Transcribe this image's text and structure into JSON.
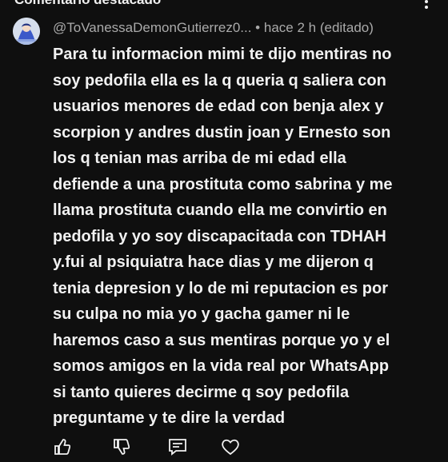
{
  "section": {
    "title": "Comentario destacado"
  },
  "comment": {
    "author": "@ToVanessaDemonGutierrez0...",
    "separator": " • ",
    "time": "hace 2 h",
    "edited": "(editado)",
    "lines": [
      "Para tu informacion mimi te dijo mentiras no",
      "soy pedofila ella es la q queria q saliera con",
      "usuarios menores de edad  con benja alex y",
      "scorpion  y andres  dustin  joan y Ernesto  son",
      "los q tenian mas arriba de mi edad ella",
      "defiende a  una prostituta como sabrina y me",
      "llama prostituta cuando ella me convirtio en",
      "pedofila   y yo soy discapacitada  con TDHAH",
      "y.fui al psiquiatra   hace dias  y me dijeron q",
      "tenia depresion y lo de mi reputacion es por",
      "su culpa no mia yo y gacha gamer ni le",
      "haremos caso a sus mentiras porque yo y el",
      "somos amigos en la vida real por WhatsApp",
      "si tanto quieres decirme q soy pedofila",
      "preguntame y te dire la verdad"
    ]
  },
  "icons": {
    "avatar": "avatar-image",
    "more": "more-vert-icon",
    "like": "thumb-up-icon",
    "dislike": "thumb-down-icon",
    "reply": "reply-icon",
    "heart": "heart-icon"
  },
  "colors": {
    "background": "#0f0f0f",
    "text": "#f1f1f1",
    "meta": "#aaaaaa"
  }
}
